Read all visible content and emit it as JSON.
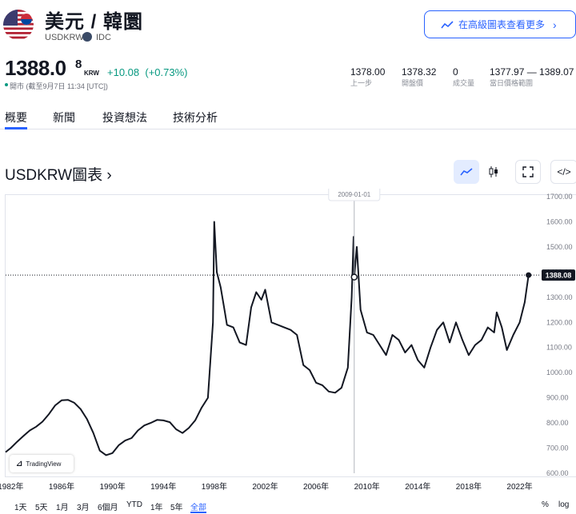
{
  "header": {
    "title": "美元 / 韓圜",
    "symbol": "USDKRW",
    "source": "IDC",
    "advanced_button": "在高級圖表查看更多"
  },
  "quote": {
    "price_main": "1388.0",
    "price_sup": "8",
    "currency": "KRW",
    "change": "+10.08",
    "change_pct": "(+0.73%)",
    "market_status": "開市 (截至9月7日 11:34 [UTC])",
    "stats": [
      {
        "value": "1378.00",
        "label": "上一步"
      },
      {
        "value": "1378.32",
        "label": "開盤價"
      },
      {
        "value": "0",
        "label": "成交量"
      },
      {
        "value": "1377.97 — 1389.07",
        "label": "當日價格範圍"
      }
    ]
  },
  "tabs": [
    "概要",
    "新聞",
    "投資想法",
    "技術分析"
  ],
  "chart_title": "USDKRW圖表 ›",
  "tooltip": {
    "value": "1380.10",
    "date": "2009-01-01"
  },
  "last_label": "1388.08",
  "logo_text": "TradingView",
  "ranges": [
    "1天",
    "5天",
    "1月",
    "3月",
    "6個月",
    "YTD",
    "1年",
    "5年",
    "全部"
  ],
  "toggles": {
    "percent": "%",
    "log": "log"
  },
  "colors": {
    "line": "#131722",
    "accent": "#2962ff",
    "positive": "#089981",
    "flag_red": "#b22234",
    "flag_blue": "#3c3b6e"
  },
  "chart_data": {
    "type": "line",
    "series": [
      {
        "values": [
          [
            1981.6,
            684
          ],
          [
            1982.0,
            700
          ],
          [
            1982.5,
            725
          ],
          [
            1983.0,
            748
          ],
          [
            1983.5,
            770
          ],
          [
            1984.0,
            785
          ],
          [
            1984.5,
            805
          ],
          [
            1985.0,
            835
          ],
          [
            1985.5,
            870
          ],
          [
            1986.0,
            890
          ],
          [
            1986.5,
            892
          ],
          [
            1987.0,
            880
          ],
          [
            1987.5,
            855
          ],
          [
            1988.0,
            815
          ],
          [
            1988.5,
            760
          ],
          [
            1989.0,
            690
          ],
          [
            1989.5,
            672
          ],
          [
            1990.0,
            680
          ],
          [
            1990.5,
            712
          ],
          [
            1991.0,
            730
          ],
          [
            1991.5,
            740
          ],
          [
            1992.0,
            770
          ],
          [
            1992.5,
            790
          ],
          [
            1993.0,
            800
          ],
          [
            1993.5,
            812
          ],
          [
            1994.0,
            810
          ],
          [
            1994.5,
            803
          ],
          [
            1995.0,
            775
          ],
          [
            1995.5,
            760
          ],
          [
            1996.0,
            780
          ],
          [
            1996.5,
            810
          ],
          [
            1997.0,
            860
          ],
          [
            1997.5,
            900
          ],
          [
            1997.9,
            1200
          ],
          [
            1998.0,
            1600
          ],
          [
            1998.2,
            1400
          ],
          [
            1998.5,
            1340
          ],
          [
            1998.8,
            1250
          ],
          [
            1999.0,
            1190
          ],
          [
            1999.5,
            1180
          ],
          [
            2000.0,
            1120
          ],
          [
            2000.5,
            1110
          ],
          [
            2000.9,
            1260
          ],
          [
            2001.3,
            1320
          ],
          [
            2001.7,
            1290
          ],
          [
            2002.0,
            1330
          ],
          [
            2002.5,
            1200
          ],
          [
            2003.0,
            1190
          ],
          [
            2003.5,
            1180
          ],
          [
            2004.0,
            1170
          ],
          [
            2004.5,
            1150
          ],
          [
            2005.0,
            1030
          ],
          [
            2005.5,
            1010
          ],
          [
            2006.0,
            960
          ],
          [
            2006.5,
            950
          ],
          [
            2007.0,
            925
          ],
          [
            2007.5,
            920
          ],
          [
            2008.0,
            940
          ],
          [
            2008.5,
            1020
          ],
          [
            2008.8,
            1300
          ],
          [
            2008.95,
            1540
          ],
          [
            2009.0,
            1380
          ],
          [
            2009.2,
            1500
          ],
          [
            2009.5,
            1250
          ],
          [
            2010.0,
            1160
          ],
          [
            2010.5,
            1150
          ],
          [
            2011.0,
            1110
          ],
          [
            2011.5,
            1070
          ],
          [
            2012.0,
            1150
          ],
          [
            2012.5,
            1130
          ],
          [
            2013.0,
            1080
          ],
          [
            2013.5,
            1110
          ],
          [
            2014.0,
            1050
          ],
          [
            2014.5,
            1020
          ],
          [
            2015.0,
            1100
          ],
          [
            2015.5,
            1170
          ],
          [
            2016.0,
            1200
          ],
          [
            2016.5,
            1120
          ],
          [
            2017.0,
            1200
          ],
          [
            2017.5,
            1130
          ],
          [
            2018.0,
            1070
          ],
          [
            2018.5,
            1110
          ],
          [
            2019.0,
            1130
          ],
          [
            2019.5,
            1180
          ],
          [
            2020.0,
            1160
          ],
          [
            2020.2,
            1240
          ],
          [
            2020.6,
            1180
          ],
          [
            2021.0,
            1090
          ],
          [
            2021.5,
            1150
          ],
          [
            2022.0,
            1200
          ],
          [
            2022.4,
            1280
          ],
          [
            2022.7,
            1388.08
          ]
        ]
      }
    ],
    "x_ticks": [
      "1982年",
      "1986年",
      "1990年",
      "1994年",
      "1998年",
      "2002年",
      "2006年",
      "2010年",
      "2014年",
      "2018年",
      "2022年"
    ],
    "y_ticks": [
      "600.00",
      "700.00",
      "800.00",
      "900.00",
      "1000.00",
      "1100.00",
      "1200.00",
      "1300.00",
      "1400.00",
      "1500.00",
      "1600.00",
      "1700.00"
    ],
    "xlim": [
      1981.6,
      2023.6
    ],
    "ylim": [
      600,
      1700
    ],
    "grid": false
  }
}
